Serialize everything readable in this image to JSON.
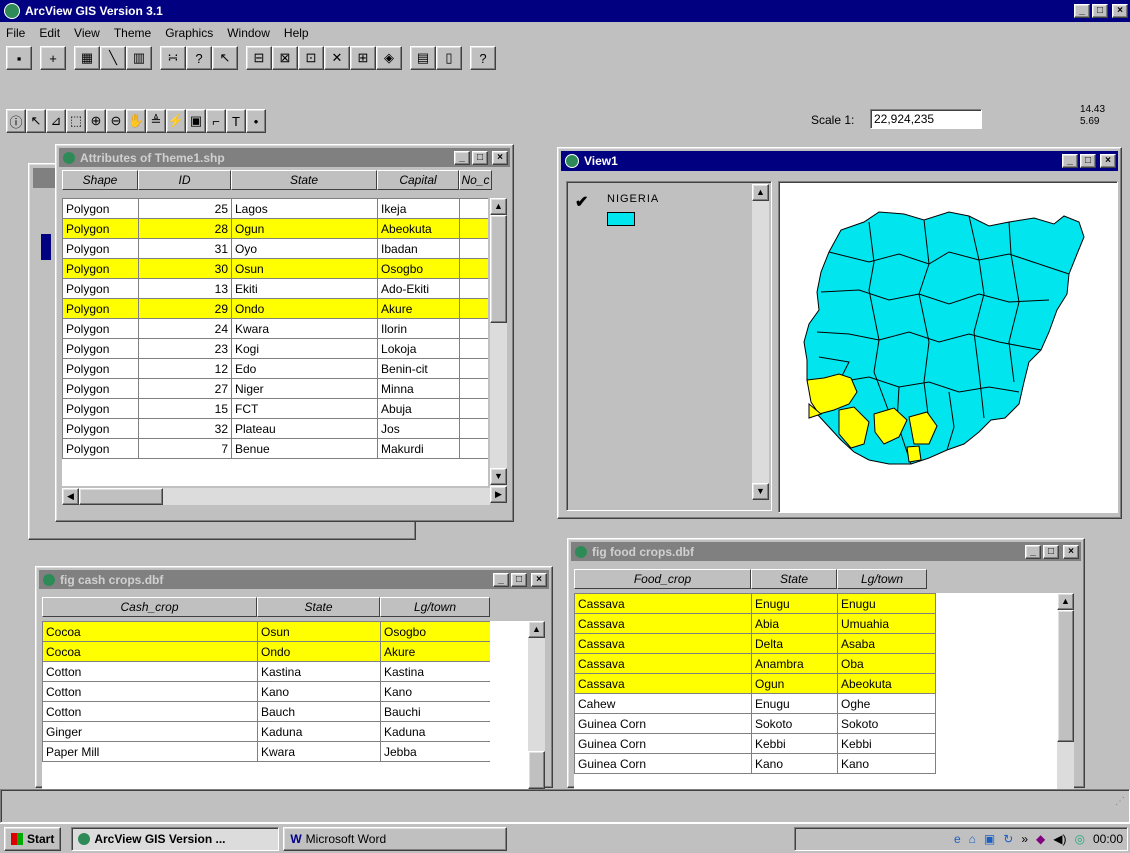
{
  "app": {
    "title": "ArcView GIS Version 3.1"
  },
  "menu": [
    "File",
    "Edit",
    "View",
    "Theme",
    "Graphics",
    "Window",
    "Help"
  ],
  "scale": {
    "label": "Scale 1:",
    "value": "22,924,235",
    "coord_x": "14.43",
    "coord_y": "5.69"
  },
  "attributes_window": {
    "title": "Attributes of Theme1.shp",
    "columns": [
      "Shape",
      "ID",
      "State",
      "Capital",
      "No_c"
    ],
    "rows": [
      {
        "shape": "Polygon",
        "id": "25",
        "state": "Lagos",
        "capital": "Ikeja",
        "hl": false
      },
      {
        "shape": "Polygon",
        "id": "28",
        "state": "Ogun",
        "capital": "Abeokuta",
        "hl": true
      },
      {
        "shape": "Polygon",
        "id": "31",
        "state": "Oyo",
        "capital": "Ibadan",
        "hl": false
      },
      {
        "shape": "Polygon",
        "id": "30",
        "state": "Osun",
        "capital": "Osogbo",
        "hl": true
      },
      {
        "shape": "Polygon",
        "id": "13",
        "state": "Ekiti",
        "capital": "Ado-Ekiti",
        "hl": false
      },
      {
        "shape": "Polygon",
        "id": "29",
        "state": "Ondo",
        "capital": "Akure",
        "hl": true
      },
      {
        "shape": "Polygon",
        "id": "24",
        "state": "Kwara",
        "capital": "Ilorin",
        "hl": false
      },
      {
        "shape": "Polygon",
        "id": "23",
        "state": "Kogi",
        "capital": "Lokoja",
        "hl": false
      },
      {
        "shape": "Polygon",
        "id": "12",
        "state": "Edo",
        "capital": "Benin-cit",
        "hl": false
      },
      {
        "shape": "Polygon",
        "id": "27",
        "state": "Niger",
        "capital": "Minna",
        "hl": false
      },
      {
        "shape": "Polygon",
        "id": "15",
        "state": "FCT",
        "capital": "Abuja",
        "hl": false
      },
      {
        "shape": "Polygon",
        "id": "32",
        "state": "Plateau",
        "capital": "Jos",
        "hl": false
      },
      {
        "shape": "Polygon",
        "id": "7",
        "state": "Benue",
        "capital": "Makurdi",
        "hl": false
      }
    ]
  },
  "view_window": {
    "title": "View1",
    "legend_label": "NIGERIA",
    "legend_color": "#00e5ee",
    "highlight_color": "#ffff00"
  },
  "cash_window": {
    "title": "fig cash crops.dbf",
    "columns": [
      "Cash_crop",
      "State",
      "Lg/town"
    ],
    "rows": [
      {
        "crop": "Cocoa",
        "state": "Osun",
        "town": "Osogbo",
        "hl": true
      },
      {
        "crop": "Cocoa",
        "state": "Ondo",
        "town": "Akure",
        "hl": true
      },
      {
        "crop": "Cotton",
        "state": "Kastina",
        "town": "Kastina",
        "hl": false
      },
      {
        "crop": "Cotton",
        "state": "Kano",
        "town": "Kano",
        "hl": false
      },
      {
        "crop": "Cotton",
        "state": "Bauch",
        "town": "Bauchi",
        "hl": false
      },
      {
        "crop": "Ginger",
        "state": "Kaduna",
        "town": "Kaduna",
        "hl": false
      },
      {
        "crop": "Paper Mill",
        "state": "Kwara",
        "town": "Jebba",
        "hl": false
      }
    ]
  },
  "food_window": {
    "title": "fig food crops.dbf",
    "columns": [
      "Food_crop",
      "State",
      "Lg/town"
    ],
    "rows": [
      {
        "crop": "Cassava",
        "state": "Enugu",
        "town": "Enugu",
        "hl": true
      },
      {
        "crop": "Cassava",
        "state": "Abia",
        "town": "Umuahia",
        "hl": true
      },
      {
        "crop": "Cassava",
        "state": "Delta",
        "town": "Asaba",
        "hl": true
      },
      {
        "crop": "Cassava",
        "state": "Anambra",
        "town": "Oba",
        "hl": true
      },
      {
        "crop": "Cassava",
        "state": "Ogun",
        "town": "Abeokuta",
        "hl": true
      },
      {
        "crop": "Cahew",
        "state": "Enugu",
        "town": "Oghe",
        "hl": false
      },
      {
        "crop": "Guinea Corn",
        "state": "Sokoto",
        "town": "Sokoto",
        "hl": false
      },
      {
        "crop": "Guinea Corn",
        "state": "Kebbi",
        "town": "Kebbi",
        "hl": false
      },
      {
        "crop": "Guinea Corn",
        "state": "Kano",
        "town": "Kano",
        "hl": false
      }
    ]
  },
  "taskbar": {
    "start": "Start",
    "tasks": [
      "ArcView GIS Version ...",
      "Microsoft Word"
    ],
    "clock": "00:00"
  }
}
